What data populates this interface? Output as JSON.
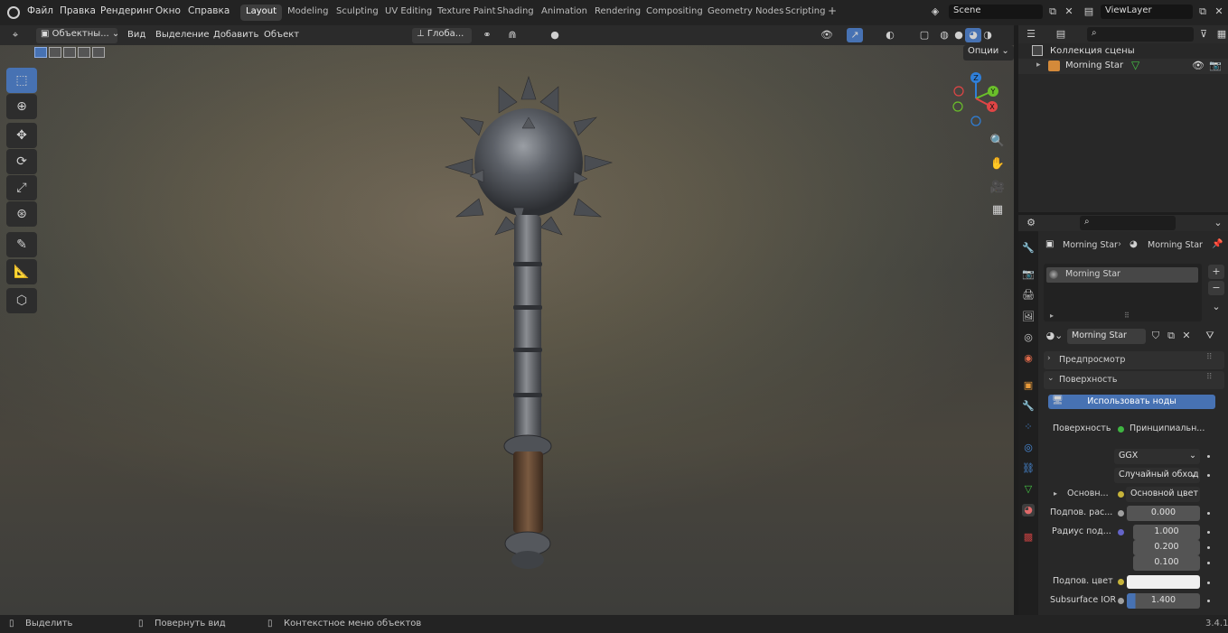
{
  "topbar": {
    "menus": [
      "Файл",
      "Правка",
      "Рендеринг",
      "Окно",
      "Справка"
    ],
    "workspaces": [
      "Layout",
      "Modeling",
      "Sculpting",
      "UV Editing",
      "Texture Paint",
      "Shading",
      "Animation",
      "Rendering",
      "Compositing",
      "Geometry Nodes",
      "Scripting"
    ],
    "active_workspace": "Layout",
    "add_tab": "+",
    "scene": "Scene",
    "view_layer": "ViewLayer"
  },
  "viewport_header": {
    "mode": "Объектны...",
    "menus": [
      "Вид",
      "Выделение",
      "Добавить",
      "Объект"
    ],
    "orientation": "Глоба...",
    "options": "Опции"
  },
  "gizmo": {
    "z": "Z",
    "y": "Y",
    "x": "X"
  },
  "outliner": {
    "collection": "Коллекция сцены",
    "object": "Morning Star"
  },
  "properties": {
    "breadcrumb_object": "Morning Star",
    "breadcrumb_material": "Morning Star",
    "slot": "Morning Star",
    "material_name": "Morning Star",
    "preview_panel": "Предпросмотр",
    "surface_panel": "Поверхность",
    "use_nodes_button": "Использовать ноды",
    "surface_label": "Поверхность",
    "surface_value": "Принципиальн...",
    "distribution": "GGX",
    "subsurface_method": "Случайный обход",
    "base_label": "Основн...",
    "base_value": "Основной цвет",
    "subsurface_label": "Подпов. рас...",
    "subsurface_value": "0.000",
    "radius_label": "Радиус под...",
    "radius_values": [
      "1.000",
      "0.200",
      "0.100"
    ],
    "subsurface_color_label": "Подпов. цвет",
    "subsurface_ior_label": "Subsurface IOR",
    "subsurface_ior_value": "1.400",
    "colors": {
      "accent": "#4772b3",
      "yellow_socket": "#c7b43a",
      "green_socket": "#3fb542",
      "blue_socket": "#6464c8"
    }
  },
  "statusbar": {
    "select": "Выделить",
    "rotate": "Повернуть вид",
    "context": "Контекстное меню объектов",
    "version": "3.4.1"
  }
}
